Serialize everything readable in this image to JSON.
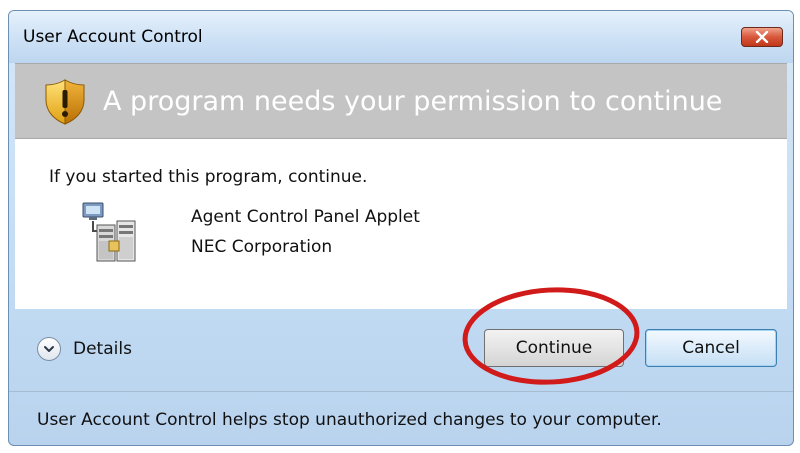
{
  "window": {
    "title": "User Account Control",
    "close_icon": "close-x-icon"
  },
  "header": {
    "icon": "shield-warning-icon",
    "message": "A program needs your permission to continue"
  },
  "content": {
    "intro": "If you started this program, continue.",
    "program": {
      "icon": "computer-network-icon",
      "name": "Agent Control Panel Applet",
      "publisher": "NEC Corporation"
    }
  },
  "details": {
    "icon": "chevron-down-icon",
    "label": "Details"
  },
  "buttons": {
    "continue_label": "Continue",
    "cancel_label": "Cancel"
  },
  "footer": {
    "text": "User Account Control helps stop unauthorized changes to your computer."
  },
  "colors": {
    "header_band": "#c4c4c4",
    "highlight_circle": "#d11a1a",
    "close_button": "#d8573a"
  }
}
